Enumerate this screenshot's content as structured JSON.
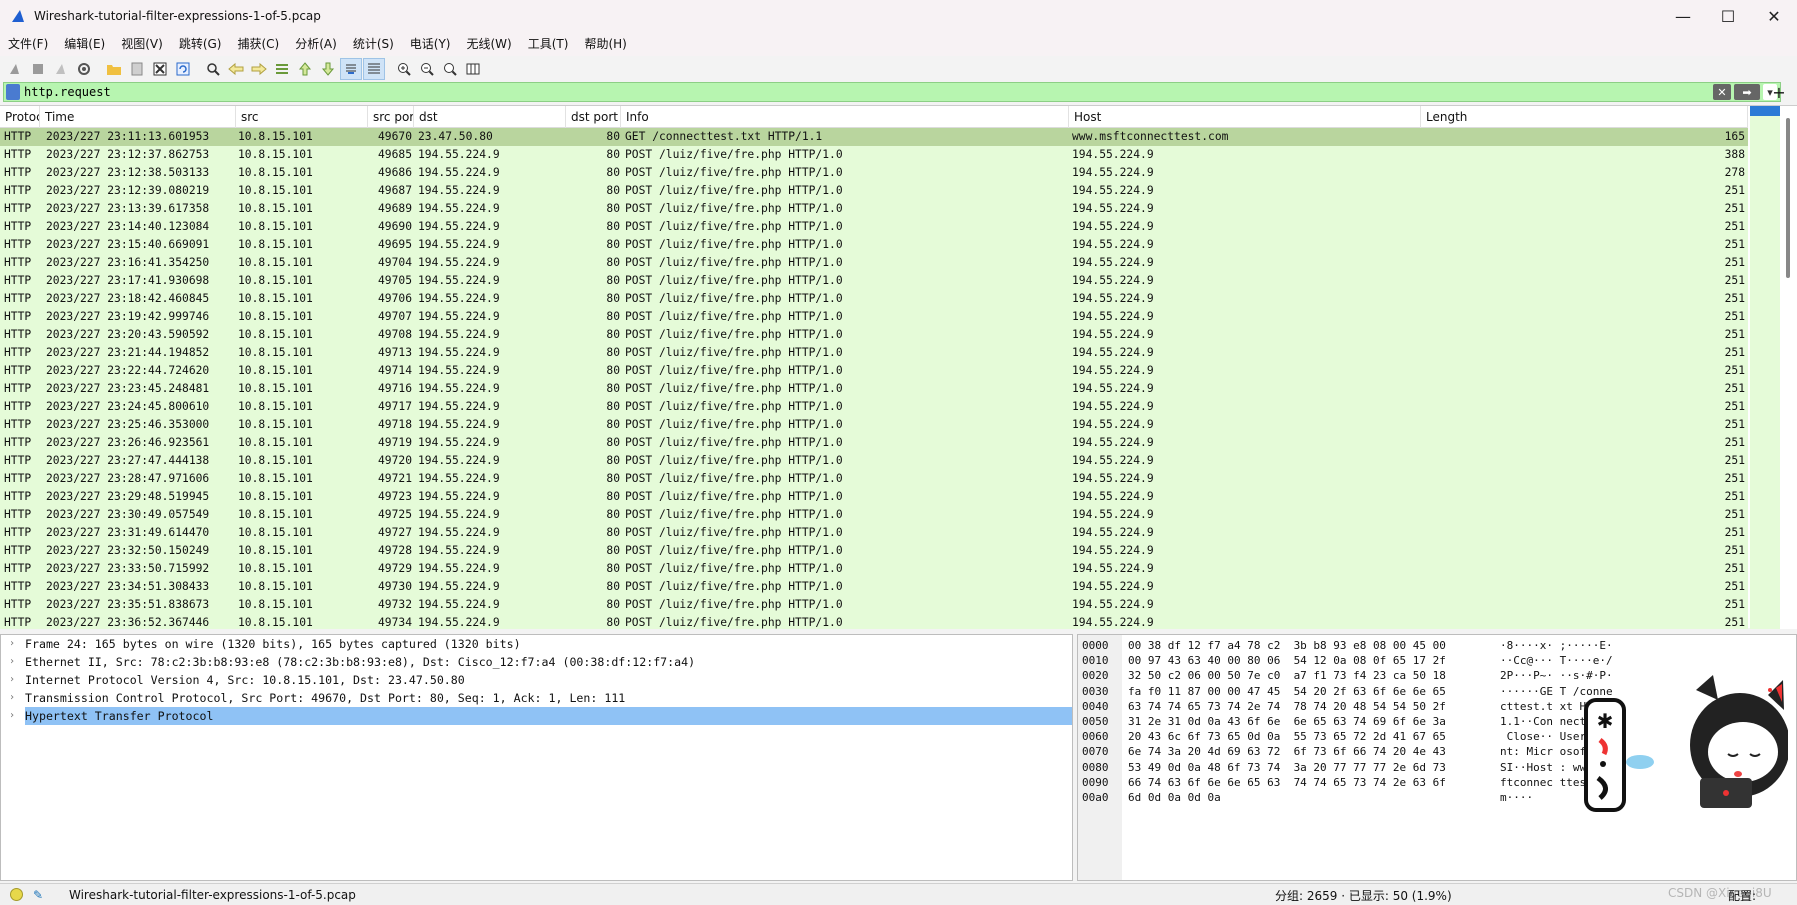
{
  "window": {
    "title": "Wireshark-tutorial-filter-expressions-1-of-5.pcap",
    "minimize": "—",
    "maximize": "☐",
    "close": "✕"
  },
  "menu": [
    "文件(F)",
    "编辑(E)",
    "视图(V)",
    "跳转(G)",
    "捕获(C)",
    "分析(A)",
    "统计(S)",
    "电话(Y)",
    "无线(W)",
    "工具(T)",
    "帮助(H)"
  ],
  "filter": {
    "value": "http.request"
  },
  "columns": [
    "Protocol",
    "Time",
    "src",
    "src port",
    "dst",
    "dst port",
    "Info",
    "Host",
    "Length"
  ],
  "packets": [
    [
      "HTTP",
      "2023/227 23:11:13.601953",
      "10.8.15.101",
      "49670",
      "23.47.50.80",
      "80",
      "GET /connecttest.txt HTTP/1.1",
      "www.msftconnecttest.com",
      "165"
    ],
    [
      "HTTP",
      "2023/227 23:12:37.862753",
      "10.8.15.101",
      "49685",
      "194.55.224.9",
      "80",
      "POST /luiz/five/fre.php HTTP/1.0",
      "194.55.224.9",
      "388"
    ],
    [
      "HTTP",
      "2023/227 23:12:38.503133",
      "10.8.15.101",
      "49686",
      "194.55.224.9",
      "80",
      "POST /luiz/five/fre.php HTTP/1.0",
      "194.55.224.9",
      "278"
    ],
    [
      "HTTP",
      "2023/227 23:12:39.080219",
      "10.8.15.101",
      "49687",
      "194.55.224.9",
      "80",
      "POST /luiz/five/fre.php HTTP/1.0",
      "194.55.224.9",
      "251"
    ],
    [
      "HTTP",
      "2023/227 23:13:39.617358",
      "10.8.15.101",
      "49689",
      "194.55.224.9",
      "80",
      "POST /luiz/five/fre.php HTTP/1.0",
      "194.55.224.9",
      "251"
    ],
    [
      "HTTP",
      "2023/227 23:14:40.123084",
      "10.8.15.101",
      "49690",
      "194.55.224.9",
      "80",
      "POST /luiz/five/fre.php HTTP/1.0",
      "194.55.224.9",
      "251"
    ],
    [
      "HTTP",
      "2023/227 23:15:40.669091",
      "10.8.15.101",
      "49695",
      "194.55.224.9",
      "80",
      "POST /luiz/five/fre.php HTTP/1.0",
      "194.55.224.9",
      "251"
    ],
    [
      "HTTP",
      "2023/227 23:16:41.354250",
      "10.8.15.101",
      "49704",
      "194.55.224.9",
      "80",
      "POST /luiz/five/fre.php HTTP/1.0",
      "194.55.224.9",
      "251"
    ],
    [
      "HTTP",
      "2023/227 23:17:41.930698",
      "10.8.15.101",
      "49705",
      "194.55.224.9",
      "80",
      "POST /luiz/five/fre.php HTTP/1.0",
      "194.55.224.9",
      "251"
    ],
    [
      "HTTP",
      "2023/227 23:18:42.460845",
      "10.8.15.101",
      "49706",
      "194.55.224.9",
      "80",
      "POST /luiz/five/fre.php HTTP/1.0",
      "194.55.224.9",
      "251"
    ],
    [
      "HTTP",
      "2023/227 23:19:42.999746",
      "10.8.15.101",
      "49707",
      "194.55.224.9",
      "80",
      "POST /luiz/five/fre.php HTTP/1.0",
      "194.55.224.9",
      "251"
    ],
    [
      "HTTP",
      "2023/227 23:20:43.590592",
      "10.8.15.101",
      "49708",
      "194.55.224.9",
      "80",
      "POST /luiz/five/fre.php HTTP/1.0",
      "194.55.224.9",
      "251"
    ],
    [
      "HTTP",
      "2023/227 23:21:44.194852",
      "10.8.15.101",
      "49713",
      "194.55.224.9",
      "80",
      "POST /luiz/five/fre.php HTTP/1.0",
      "194.55.224.9",
      "251"
    ],
    [
      "HTTP",
      "2023/227 23:22:44.724620",
      "10.8.15.101",
      "49714",
      "194.55.224.9",
      "80",
      "POST /luiz/five/fre.php HTTP/1.0",
      "194.55.224.9",
      "251"
    ],
    [
      "HTTP",
      "2023/227 23:23:45.248481",
      "10.8.15.101",
      "49716",
      "194.55.224.9",
      "80",
      "POST /luiz/five/fre.php HTTP/1.0",
      "194.55.224.9",
      "251"
    ],
    [
      "HTTP",
      "2023/227 23:24:45.800610",
      "10.8.15.101",
      "49717",
      "194.55.224.9",
      "80",
      "POST /luiz/five/fre.php HTTP/1.0",
      "194.55.224.9",
      "251"
    ],
    [
      "HTTP",
      "2023/227 23:25:46.353000",
      "10.8.15.101",
      "49718",
      "194.55.224.9",
      "80",
      "POST /luiz/five/fre.php HTTP/1.0",
      "194.55.224.9",
      "251"
    ],
    [
      "HTTP",
      "2023/227 23:26:46.923561",
      "10.8.15.101",
      "49719",
      "194.55.224.9",
      "80",
      "POST /luiz/five/fre.php HTTP/1.0",
      "194.55.224.9",
      "251"
    ],
    [
      "HTTP",
      "2023/227 23:27:47.444138",
      "10.8.15.101",
      "49720",
      "194.55.224.9",
      "80",
      "POST /luiz/five/fre.php HTTP/1.0",
      "194.55.224.9",
      "251"
    ],
    [
      "HTTP",
      "2023/227 23:28:47.971606",
      "10.8.15.101",
      "49721",
      "194.55.224.9",
      "80",
      "POST /luiz/five/fre.php HTTP/1.0",
      "194.55.224.9",
      "251"
    ],
    [
      "HTTP",
      "2023/227 23:29:48.519945",
      "10.8.15.101",
      "49723",
      "194.55.224.9",
      "80",
      "POST /luiz/five/fre.php HTTP/1.0",
      "194.55.224.9",
      "251"
    ],
    [
      "HTTP",
      "2023/227 23:30:49.057549",
      "10.8.15.101",
      "49725",
      "194.55.224.9",
      "80",
      "POST /luiz/five/fre.php HTTP/1.0",
      "194.55.224.9",
      "251"
    ],
    [
      "HTTP",
      "2023/227 23:31:49.614470",
      "10.8.15.101",
      "49727",
      "194.55.224.9",
      "80",
      "POST /luiz/five/fre.php HTTP/1.0",
      "194.55.224.9",
      "251"
    ],
    [
      "HTTP",
      "2023/227 23:32:50.150249",
      "10.8.15.101",
      "49728",
      "194.55.224.9",
      "80",
      "POST /luiz/five/fre.php HTTP/1.0",
      "194.55.224.9",
      "251"
    ],
    [
      "HTTP",
      "2023/227 23:33:50.715992",
      "10.8.15.101",
      "49729",
      "194.55.224.9",
      "80",
      "POST /luiz/five/fre.php HTTP/1.0",
      "194.55.224.9",
      "251"
    ],
    [
      "HTTP",
      "2023/227 23:34:51.308433",
      "10.8.15.101",
      "49730",
      "194.55.224.9",
      "80",
      "POST /luiz/five/fre.php HTTP/1.0",
      "194.55.224.9",
      "251"
    ],
    [
      "HTTP",
      "2023/227 23:35:51.838673",
      "10.8.15.101",
      "49732",
      "194.55.224.9",
      "80",
      "POST /luiz/five/fre.php HTTP/1.0",
      "194.55.224.9",
      "251"
    ],
    [
      "HTTP",
      "2023/227 23:36:52.367446",
      "10.8.15.101",
      "49734",
      "194.55.224.9",
      "80",
      "POST /luiz/five/fre.php HTTP/1.0",
      "194.55.224.9",
      "251"
    ]
  ],
  "details": [
    "Frame 24: 165 bytes on wire (1320 bits), 165 bytes captured (1320 bits)",
    "Ethernet II, Src: 78:c2:3b:b8:93:e8 (78:c2:3b:b8:93:e8), Dst: Cisco_12:f7:a4 (00:38:df:12:f7:a4)",
    "Internet Protocol Version 4, Src: 10.8.15.101, Dst: 23.47.50.80",
    "Transmission Control Protocol, Src Port: 49670, Dst Port: 80, Seq: 1, Ack: 1, Len: 111",
    "Hypertext Transfer Protocol"
  ],
  "hex": [
    {
      "off": "0000",
      "hex": "00 38 df 12 f7 a4 78 c2  3b b8 93 e8 08 00 45 00",
      "asc": "·8····x· ;·····E·"
    },
    {
      "off": "0010",
      "hex": "00 97 43 63 40 00 80 06  54 12 0a 08 0f 65 17 2f",
      "asc": "··Cc@··· T····e·/"
    },
    {
      "off": "0020",
      "hex": "32 50 c2 06 00 50 7e c0  a7 f1 73 f4 23 ca 50 18",
      "asc": "2P···P~· ··s·#·P·"
    },
    {
      "off": "0030",
      "hex": "fa f0 11 87 00 00 47 45  54 20 2f 63 6f 6e 6e 65",
      "asc": "······GE T /conne"
    },
    {
      "off": "0040",
      "hex": "63 74 74 65 73 74 2e 74  78 74 20 48 54 54 50 2f",
      "asc": "cttest.t xt HTTP/"
    },
    {
      "off": "0050",
      "hex": "31 2e 31 0d 0a 43 6f 6e  6e 65 63 74 69 6f 6e 3a",
      "asc": "1.1··Con nection:"
    },
    {
      "off": "0060",
      "hex": "20 43 6c 6f 73 65 0d 0a  55 73 65 72 2d 41 67 65",
      "asc": " Close·· User-Age"
    },
    {
      "off": "0070",
      "hex": "6e 74 3a 20 4d 69 63 72  6f 73 6f 66 74 20 4e 43",
      "asc": "nt: Micr osoft NC"
    },
    {
      "off": "0080",
      "hex": "53 49 0d 0a 48 6f 73 74  3a 20 77 77 77 2e 6d 73",
      "asc": "SI··Host : www.ms"
    },
    {
      "off": "0090",
      "hex": "66 74 63 6f 6e 6e 65 63  74 74 65 73 74 2e 63 6f",
      "asc": "ftconnec ttest.co"
    },
    {
      "off": "00a0",
      "hex": "6d 0d 0a 0d 0a",
      "asc": "m····"
    }
  ],
  "status": {
    "file": "Wireshark-tutorial-filter-expressions-1-of-5.pcap",
    "stats": "分组: 2659 · 已显示: 50 (1.9%)",
    "profile": "配置: Default",
    "watermark": "CSDN @Xiaoqi8U"
  },
  "colors": {
    "row_bg": "#e5fbd8",
    "row_selected": "#b9d59e",
    "filter_bg": "#b7f5b0",
    "detail_selected": "#8fc2f5"
  },
  "icons": [
    "shark-fin-icon",
    "start-capture-icon",
    "stop-capture-icon",
    "restart-capture-icon",
    "capture-options-icon",
    "open-file-icon",
    "save-file-icon",
    "close-file-icon",
    "reload-icon",
    "find-icon",
    "back-icon",
    "forward-icon",
    "goto-packet-icon",
    "first-packet-icon",
    "last-packet-icon",
    "autoscroll-icon",
    "colorize-icon",
    "zoom-in-icon",
    "zoom-out-icon",
    "normal-size-icon",
    "resize-columns-icon"
  ]
}
